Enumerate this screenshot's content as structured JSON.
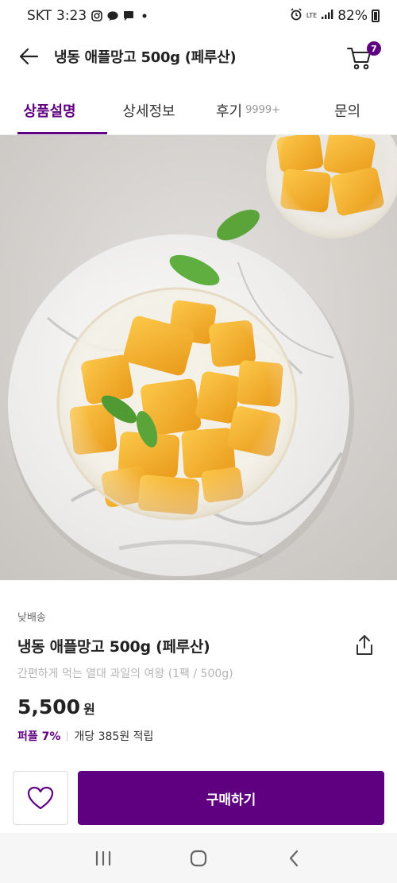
{
  "status_bar": {
    "carrier": "SKT",
    "time": "3:23",
    "network": "LTE",
    "battery": "82%"
  },
  "header": {
    "title": "냉동 애플망고 500g (페루산)",
    "cart_count": "7"
  },
  "tabs": [
    {
      "label": "상품설명",
      "active": true
    },
    {
      "label": "상세정보"
    },
    {
      "label": "후기",
      "count": "9999+"
    },
    {
      "label": "문의"
    }
  ],
  "product": {
    "delivery_tag": "낮배송",
    "name": "냉동 애플망고 500g (페루산)",
    "description": "간편하게 먹는 열대 과일의 여왕 (1팩 / 500g)",
    "price": "5,500",
    "currency": "원",
    "tier_label": "퍼플 7%",
    "points_text": "개당 385원 적립"
  },
  "bottom_bar": {
    "buy_label": "구매하기"
  },
  "colors": {
    "brand": "#5f0080"
  }
}
